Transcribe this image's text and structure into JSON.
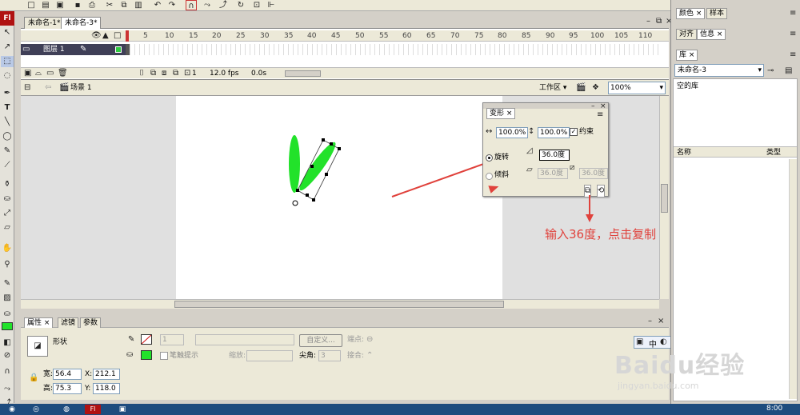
{
  "toolbar_icons": [
    "new-icon",
    "open-icon",
    "save-icon",
    "print-icon",
    "cut-icon",
    "copy-icon",
    "paste-icon",
    "undo-icon",
    "redo-icon",
    "snap-icon",
    "smooth-icon",
    "straighten-icon",
    "rotate-icon",
    "scale-icon",
    "align-icon"
  ],
  "app_logo": "Fl",
  "doc_tabs": [
    {
      "label": "未命名-1*"
    },
    {
      "label": "未命名-3*"
    }
  ],
  "timeline": {
    "frame_numbers": [
      "5",
      "10",
      "15",
      "20",
      "25",
      "30",
      "35",
      "40",
      "45",
      "50",
      "55",
      "60",
      "65",
      "70",
      "75",
      "80",
      "85",
      "90",
      "95",
      "100",
      "105",
      "110"
    ],
    "layer_name": "图层 1",
    "current_frame": "1",
    "fps": "12.0 fps",
    "time": "0.0s"
  },
  "breadcrumb": {
    "scene": "场景 1",
    "workspace": "工作区",
    "zoom": "100%"
  },
  "transform_panel": {
    "tab": "变形",
    "width_pct": "100.0%",
    "height_pct": "100.0%",
    "constrain_label": "约束",
    "constrain_checked": true,
    "rotate_label": "旋转",
    "rotate_value": "36.0度",
    "skew_label": "倾斜",
    "skew_h": "36.0度",
    "skew_v": "36.0度"
  },
  "annotation": "输入36度，点击复制",
  "properties": {
    "tabs": [
      "属性",
      "滤镜",
      "参数"
    ],
    "shape_label": "形状",
    "stroke_value": "1",
    "custom_button": "自定义...",
    "cap_label": "端点:",
    "hint_label": "笔触提示",
    "scale_label": "缩放:",
    "miter_label": "尖角:",
    "miter_value": "3",
    "join_label": "接合:",
    "w_label": "宽:",
    "w_value": "56.4",
    "h_label": "高:",
    "h_value": "75.3",
    "x_label": "X:",
    "x_value": "212.1",
    "y_label": "Y:",
    "y_value": "118.0"
  },
  "right_panel": {
    "tabs_top": [
      "颜色",
      "样本"
    ],
    "tabs_mid": [
      "对齐",
      "信息"
    ],
    "library_tab": "库",
    "library_doc": "未命名-3",
    "empty_library": "空的库",
    "col_name": "名称",
    "col_type": "类型"
  },
  "ime_label": "中",
  "watermark": {
    "brand": "Baidu经验",
    "url": "jingyan.baidu.com"
  },
  "taskbar": {
    "app": "Fl",
    "clock": "8:00"
  },
  "colors": {
    "fill": "#22e22a",
    "accent_red": "#e0423c",
    "layer_bg": "#3f3f57"
  }
}
